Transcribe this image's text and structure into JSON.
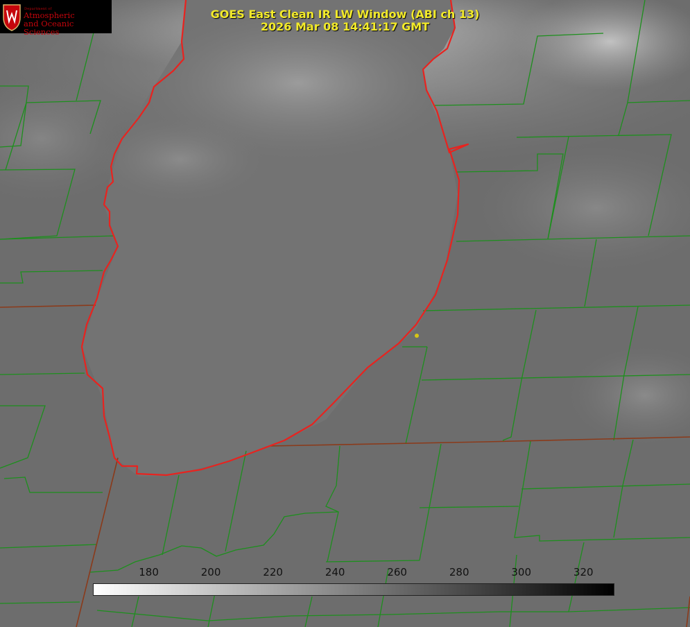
{
  "header": {
    "title_line1": "GOES East Clean IR LW Window (ABI ch 13)",
    "title_line2": "2026 Mar 08 14:41:17 GMT",
    "title_color": "#f2ea2a"
  },
  "logo": {
    "department": "Department of",
    "line1": "Atmospheric",
    "line2": "and Oceanic Sciences",
    "icon": "uw-crest-icon",
    "color": "#c5050c"
  },
  "colorbar": {
    "ticks": [
      "180",
      "200",
      "220",
      "240",
      "260",
      "280",
      "300",
      "320"
    ],
    "tick_values": [
      180,
      200,
      220,
      240,
      260,
      280,
      300,
      320
    ],
    "range": [
      162,
      330
    ],
    "gradient": [
      "#ffffff",
      "#000000"
    ]
  },
  "map": {
    "boundary_color": "#1d8f1d",
    "coastline_color": "#e8231f",
    "marker_color": "#d7c515",
    "marker_icon": "location-dot-icon"
  }
}
